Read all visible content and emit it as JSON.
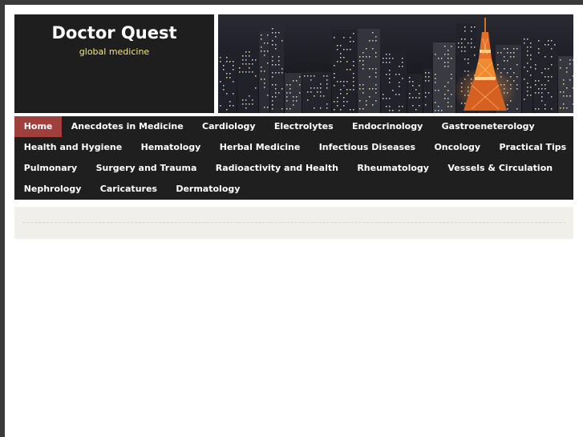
{
  "site": {
    "title": "Doctor Quest",
    "tagline": "global medicine"
  },
  "header_image": {
    "icon": "city-skyline-tokyo-tower-image"
  },
  "nav": {
    "rows": [
      [
        {
          "label": "Home",
          "active": true
        },
        {
          "label": "Anecdotes in Medicine"
        },
        {
          "label": "Cardiology"
        },
        {
          "label": "Electrolytes"
        },
        {
          "label": "Endocrinology"
        },
        {
          "label": "Gastroeneterology"
        }
      ],
      [
        {
          "label": "Health and Hygiene"
        },
        {
          "label": "Hematology"
        },
        {
          "label": "Herbal Medicine"
        },
        {
          "label": "Infectious Diseases"
        },
        {
          "label": "Oncology"
        },
        {
          "label": "Practical Tips"
        }
      ],
      [
        {
          "label": "Pulmonary"
        },
        {
          "label": "Surgery and Trauma"
        },
        {
          "label": "Radioactivity and Health"
        },
        {
          "label": "Rheumatology"
        },
        {
          "label": "Vessels & Circulation"
        }
      ],
      [
        {
          "label": "Nephrology"
        },
        {
          "label": "Caricatures"
        },
        {
          "label": "Dermatology"
        }
      ]
    ]
  },
  "colors": {
    "nav_background": "#1f1f1f",
    "nav_active": "#a0403d",
    "tagline": "#f0e68c",
    "content_bar": "#f1efea"
  }
}
